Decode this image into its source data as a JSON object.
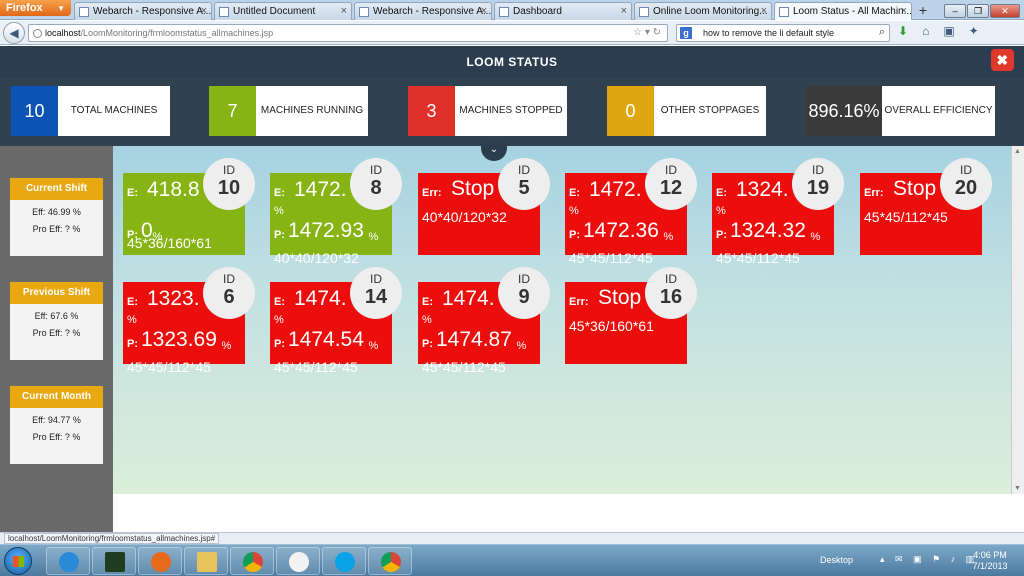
{
  "browser": {
    "menu_button": "Firefox",
    "tabs": [
      {
        "label": "Webarch - Responsive A...",
        "active": false
      },
      {
        "label": "Untitled Document",
        "active": false
      },
      {
        "label": "Webarch - Responsive A...",
        "active": false
      },
      {
        "label": "Dashboard",
        "active": false
      },
      {
        "label": "Online Loom Monitoring...",
        "active": false
      },
      {
        "label": "Loom Status - All Machin...",
        "active": true
      }
    ],
    "url_host": "localhost",
    "url_path": "/LoomMonitoring/frmloomstatus_allmachines.jsp",
    "search_text": "how to remove the li default style",
    "status_link": "localhost/LoomMonitoring/frmloomstatus_allmachines.jsp#"
  },
  "page": {
    "title": "LOOM STATUS",
    "close_label": "✖"
  },
  "summary": [
    {
      "value": "10",
      "label": "TOTAL MACHINES",
      "color": "#0d53b5"
    },
    {
      "value": "7",
      "label": "MACHINES RUNNING",
      "color": "#86b414"
    },
    {
      "value": "3",
      "label": "MACHINES STOPPED",
      "color": "#e0302a"
    },
    {
      "value": "0",
      "label": "OTHER STOPPAGES",
      "color": "#e0a611"
    },
    {
      "value": "896.16%",
      "label": "OVERALL EFFICIENCY",
      "color": "#3a3a3a"
    }
  ],
  "shifts": [
    {
      "title": "Current Shift",
      "eff": "Eff: 46.99 %",
      "pro_eff": "Pro Eff: ? %"
    },
    {
      "title": "Previous Shift",
      "eff": "Eff: 67.6 %",
      "pro_eff": "Pro Eff: ? %"
    },
    {
      "title": "Current Month",
      "eff": "Eff: 94.77 %",
      "pro_eff": "Pro Eff: ? %"
    }
  ],
  "id_label": "ID",
  "machines": [
    {
      "id": "10",
      "color": "green",
      "type": "run",
      "e_label": "E:",
      "e_value": "418.8",
      "e_pct": "",
      "p_label": "P:",
      "p_value": "0",
      "p_pct": "%",
      "dims": "45*36/160*61"
    },
    {
      "id": "8",
      "color": "green",
      "type": "run",
      "e_label": "E:",
      "e_value": "1472.",
      "e_pct": "%",
      "p_label": "P:",
      "p_value": "1472.93",
      "p_pct": "%",
      "dims": "40*40/120*32"
    },
    {
      "id": "5",
      "color": "red",
      "type": "err",
      "err_label": "Err:",
      "err_value": "Stop",
      "dims": "40*40/120*32"
    },
    {
      "id": "12",
      "color": "red",
      "type": "run",
      "e_label": "E:",
      "e_value": "1472.",
      "e_pct": "%",
      "p_label": "P:",
      "p_value": "1472.36",
      "p_pct": "%",
      "dims": "45*45/112*45"
    },
    {
      "id": "19",
      "color": "red",
      "type": "run",
      "e_label": "E:",
      "e_value": "1324.",
      "e_pct": "%",
      "p_label": "P:",
      "p_value": "1324.32",
      "p_pct": "%",
      "dims": "45*45/112*45"
    },
    {
      "id": "20",
      "color": "red",
      "type": "err",
      "err_label": "Err:",
      "err_value": "Stop",
      "dims": "45*45/112*45"
    },
    {
      "id": "6",
      "color": "red",
      "type": "run",
      "e_label": "E:",
      "e_value": "1323.",
      "e_pct": "%",
      "p_label": "P:",
      "p_value": "1323.69",
      "p_pct": "%",
      "dims": "45*45/112*45"
    },
    {
      "id": "14",
      "color": "red",
      "type": "run",
      "e_label": "E:",
      "e_value": "1474.",
      "e_pct": "%",
      "p_label": "P:",
      "p_value": "1474.54",
      "p_pct": "%",
      "dims": "45*45/112*45"
    },
    {
      "id": "9",
      "color": "red",
      "type": "run",
      "e_label": "E:",
      "e_value": "1474.",
      "e_pct": "%",
      "p_label": "P:",
      "p_value": "1474.87",
      "p_pct": "%",
      "dims": "45*45/112*45"
    },
    {
      "id": "16",
      "color": "red",
      "type": "err",
      "err_label": "Err:",
      "err_value": "Stop",
      "dims": "45*36/160*61"
    }
  ],
  "taskbar": {
    "desktop_label": "Desktop",
    "time": "4:06 PM",
    "date": "7/1/2013",
    "apps": [
      "windows-explorer",
      "internet-explorer",
      "dreamweaver",
      "firefox",
      "folder",
      "chrome",
      "google-talk",
      "skype",
      "chrome"
    ]
  }
}
